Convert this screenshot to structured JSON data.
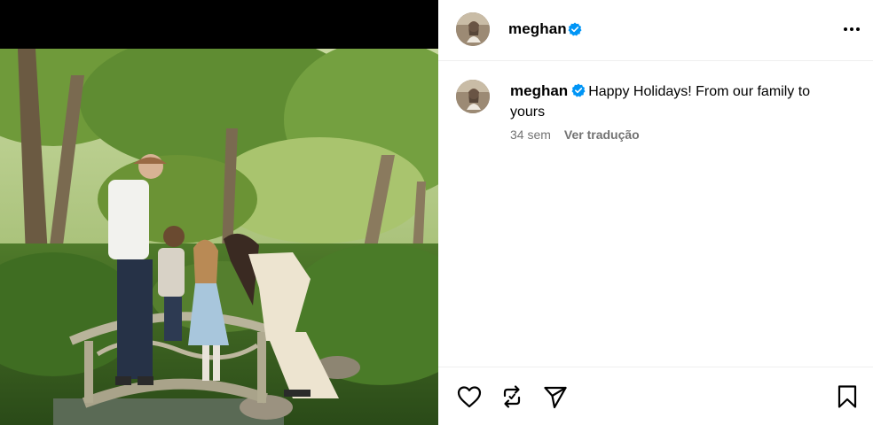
{
  "post": {
    "author": {
      "username": "meghan",
      "verified": true,
      "avatar_icon": "profile-avatar"
    },
    "caption": {
      "username": "meghan",
      "text": "Happy Holidays! From our family to yours"
    },
    "meta": {
      "age": "34 sem",
      "translate_label": "Ver tradução"
    },
    "media": {
      "description": "photo"
    },
    "actions": {
      "like_icon": "heart-icon",
      "repost_icon": "repost-icon",
      "share_icon": "send-icon",
      "save_icon": "bookmark-icon",
      "more_icon": "more-options-icon"
    }
  },
  "colors": {
    "verified_blue": "#0095f6",
    "secondary_text": "#737373",
    "divider": "#efefef"
  }
}
